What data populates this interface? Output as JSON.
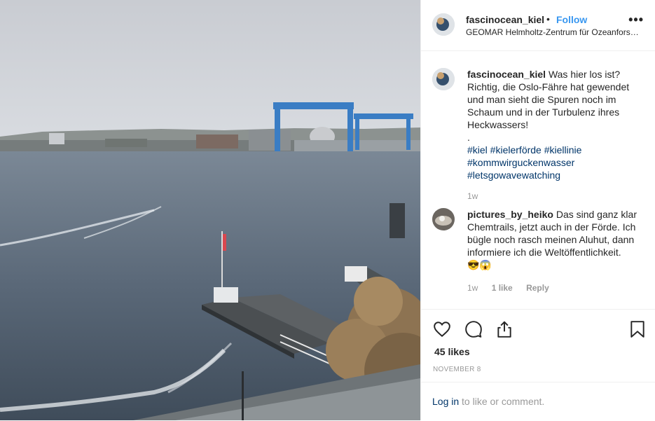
{
  "post": {
    "username": "fascinocean_kiel",
    "separator": "•",
    "follow_label": "Follow",
    "location": "GEOMAR Helmholtz-Zentrum für Ozeanforschung Kiel",
    "more_label": "•••"
  },
  "caption": {
    "username": "fascinocean_kiel",
    "text": "Was hier los ist? Richtig, die Oslo-Fähre hat gewendet und man sieht die Spuren noch im Schaum und in der Turbulenz ihres Heckwassers!",
    "dot": ".",
    "hashtags": "#kiel #kielerförde #kiellinie #kommwirguckenwasser #letsgowavewatching",
    "time": "1w"
  },
  "comment": {
    "username": "pictures_by_heiko",
    "text": "Das sind ganz klar Chemtrails, jetzt auch in der Förde. Ich bügle noch rasch meinen Aluhut, dann informiere ich die Weltöffentlichkeit.",
    "emojis": "😎😱",
    "time": "1w",
    "likes": "1 like",
    "reply_label": "Reply"
  },
  "actions": {
    "icons": [
      "heart-icon",
      "comment-icon",
      "share-icon",
      "bookmark-icon"
    ],
    "likes": "45 likes",
    "date": "NOVEMBER 8"
  },
  "login": {
    "link_text": "Log in",
    "rest_text": " to like or comment."
  },
  "colors": {
    "link": "#3897f0",
    "hashtag": "#003569",
    "muted": "#999999",
    "crane_blue": "#3a7dc4"
  }
}
